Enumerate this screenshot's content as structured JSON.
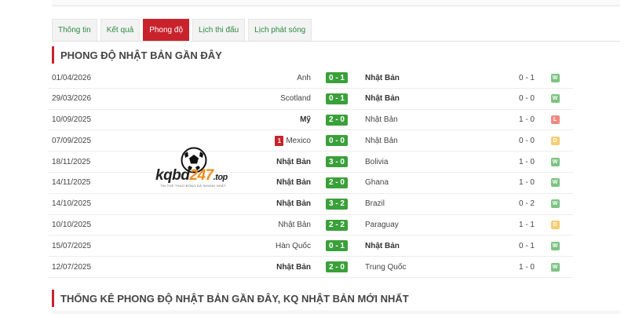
{
  "tabs": [
    {
      "label": "Thông tin"
    },
    {
      "label": "Kết quả"
    },
    {
      "label": "Phong độ",
      "active": true
    },
    {
      "label": "Lịch thi đấu"
    },
    {
      "label": "Lịch phát sóng"
    }
  ],
  "section_title": "PHONG ĐỘ NHẬT BẢN GẦN ĐÂY",
  "matches": [
    {
      "date": "01/04/2026",
      "home": "Anh",
      "home_bold": false,
      "score": "0 - 1",
      "away": "Nhật Bản",
      "away_bold": true,
      "ht": "0 - 1",
      "result": "W",
      "red_card": ""
    },
    {
      "date": "29/03/2026",
      "home": "Scotland",
      "home_bold": false,
      "score": "0 - 1",
      "away": "Nhật Bản",
      "away_bold": true,
      "ht": "0 - 0",
      "result": "W",
      "red_card": ""
    },
    {
      "date": "10/09/2025",
      "home": "Mỹ",
      "home_bold": true,
      "score": "2 - 0",
      "away": "Nhật Bản",
      "away_bold": false,
      "ht": "1 - 0",
      "result": "L",
      "red_card": ""
    },
    {
      "date": "07/09/2025",
      "home": "Mexico",
      "home_bold": false,
      "score": "0 - 0",
      "away": "Nhật Bản",
      "away_bold": false,
      "ht": "0 - 0",
      "result": "D",
      "red_card": "1"
    },
    {
      "date": "18/11/2025",
      "home": "Nhật Bản",
      "home_bold": true,
      "score": "3 - 0",
      "away": "Bolivia",
      "away_bold": false,
      "ht": "1 - 0",
      "result": "W",
      "red_card": ""
    },
    {
      "date": "14/11/2025",
      "home": "Nhật Bản",
      "home_bold": true,
      "score": "2 - 0",
      "away": "Ghana",
      "away_bold": false,
      "ht": "1 - 0",
      "result": "W",
      "red_card": ""
    },
    {
      "date": "14/10/2025",
      "home": "Nhật Bản",
      "home_bold": true,
      "score": "3 - 2",
      "away": "Brazil",
      "away_bold": false,
      "ht": "0 - 2",
      "result": "W",
      "red_card": ""
    },
    {
      "date": "10/10/2025",
      "home": "Nhật Bản",
      "home_bold": false,
      "score": "2 - 2",
      "away": "Paraguay",
      "away_bold": false,
      "ht": "1 - 1",
      "result": "D",
      "red_card": ""
    },
    {
      "date": "15/07/2025",
      "home": "Hàn Quốc",
      "home_bold": false,
      "score": "0 - 1",
      "away": "Nhật Bản",
      "away_bold": true,
      "ht": "0 - 1",
      "result": "W",
      "red_card": ""
    },
    {
      "date": "12/07/2025",
      "home": "Nhật Bản",
      "home_bold": true,
      "score": "2 - 0",
      "away": "Trung Quốc",
      "away_bold": false,
      "ht": "1 - 0",
      "result": "W",
      "red_card": ""
    }
  ],
  "section_title_2": "THỐNG KÊ PHONG ĐỘ NHẬT BẢN GẦN ĐÂY, KQ NHẬT BẢN MỚI NHẤT",
  "watermark": {
    "text_main": "kqbd",
    "text_accent": "247",
    "text_suffix": ".top",
    "tagline": "TIN THỂ THAO BÓNG ĐÁ NHANH NHẤT"
  },
  "colors": {
    "accent": "#c8232c",
    "score_green": "#3aa03a",
    "win": "#7dc383",
    "loss": "#ef8a80",
    "draw": "#f5cd73",
    "link_green": "#2d8a3e"
  }
}
